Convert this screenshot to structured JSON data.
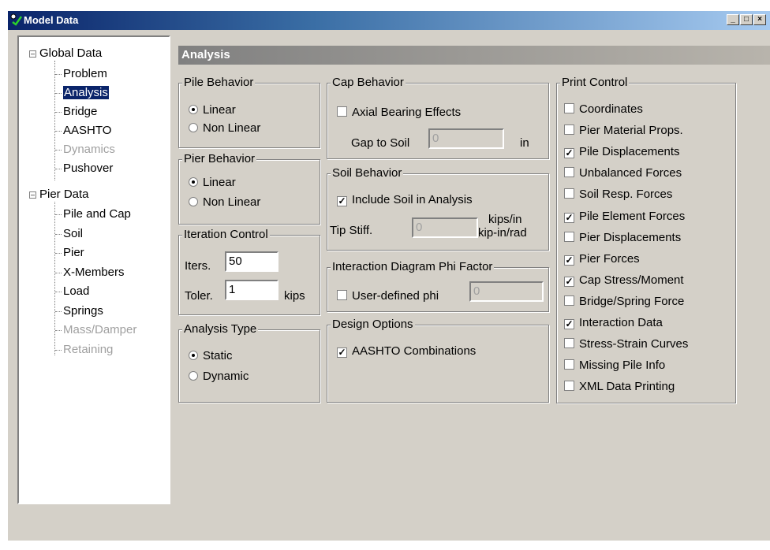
{
  "window": {
    "title": "Model Data",
    "minimize_glyph": "_",
    "maximize_glyph": "□",
    "close_glyph": "×"
  },
  "tree": {
    "global": {
      "label": "Global Data",
      "children": [
        "Problem",
        "Analysis",
        "Bridge",
        "AASHTO",
        "Dynamics",
        "Pushover"
      ]
    },
    "pier": {
      "label": "Pier Data",
      "children": [
        "Pile and Cap",
        "Soil",
        "Pier",
        "X-Members",
        "Load",
        "Springs",
        "Mass/Damper",
        "Retaining"
      ]
    },
    "selected": "Analysis",
    "disabled": [
      "Dynamics",
      "Mass/Damper",
      "Retaining"
    ]
  },
  "section_title": "Analysis",
  "pile_behavior": {
    "title": "Pile Behavior",
    "options": [
      "Linear",
      "Non Linear"
    ],
    "selected": "Linear"
  },
  "pier_behavior": {
    "title": "Pier Behavior",
    "options": [
      "Linear",
      "Non Linear"
    ],
    "selected": "Linear"
  },
  "iteration": {
    "title": "Iteration Control",
    "iters_label": "Iters.",
    "iters_value": "50",
    "toler_label": "Toler.",
    "toler_value": "1",
    "toler_unit": "kips"
  },
  "analysis_type": {
    "title": "Analysis Type",
    "options": [
      "Static",
      "Dynamic"
    ],
    "selected": "Static"
  },
  "cap_behavior": {
    "title": "Cap Behavior",
    "axial_label": "Axial Bearing Effects",
    "axial_checked": false,
    "gap_label": "Gap to Soil",
    "gap_value": "0",
    "gap_unit": "in"
  },
  "soil_behavior": {
    "title": "Soil Behavior",
    "include_label": "Include Soil in Analysis",
    "include_checked": true,
    "tip_label": "Tip Stiff.",
    "tip_value": "0",
    "unit1": "kips/in",
    "unit2": "kip-in/rad"
  },
  "interaction": {
    "title": "Interaction Diagram Phi Factor",
    "user_label": "User-defined phi",
    "user_checked": false,
    "phi_value": "0"
  },
  "design": {
    "title": "Design Options",
    "aashto_label": "AASHTO Combinations",
    "aashto_checked": true
  },
  "print_control": {
    "title": "Print Control",
    "items": [
      {
        "label": "Coordinates",
        "checked": false
      },
      {
        "label": "Pier Material Props.",
        "checked": false
      },
      {
        "label": "Pile Displacements",
        "checked": true
      },
      {
        "label": "Unbalanced Forces",
        "checked": false
      },
      {
        "label": "Soil Resp. Forces",
        "checked": false
      },
      {
        "label": "Pile Element Forces",
        "checked": true
      },
      {
        "label": "Pier Displacements",
        "checked": false
      },
      {
        "label": "Pier Forces",
        "checked": true
      },
      {
        "label": "Cap Stress/Moment",
        "checked": true
      },
      {
        "label": "Bridge/Spring Force",
        "checked": false
      },
      {
        "label": "Interaction Data",
        "checked": true
      },
      {
        "label": "Stress-Strain Curves",
        "checked": false
      },
      {
        "label": "Missing Pile Info",
        "checked": false
      },
      {
        "label": "XML Data Printing",
        "checked": false
      }
    ]
  }
}
